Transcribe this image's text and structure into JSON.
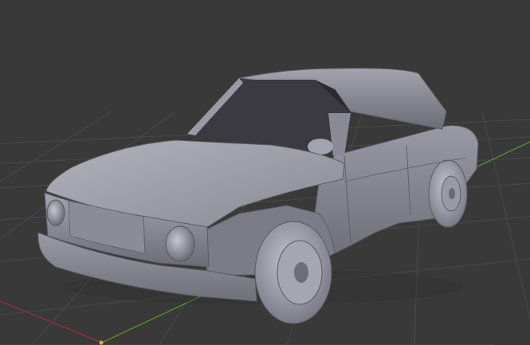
{
  "viewport": {
    "mode": "3d-solid-view",
    "background_color": "#393939",
    "grid_color": "#4a4a4a",
    "axis_x_color": "#9a3535",
    "axis_y_color": "#5c9a2e",
    "origin_color": "#e0a040"
  },
  "model": {
    "icon": "car-model-icon",
    "body_color": "#8a8a96",
    "highlight_color": "#b8b8c4",
    "shadow_color": "#56565e",
    "glass_color": "#2a2a2e"
  }
}
